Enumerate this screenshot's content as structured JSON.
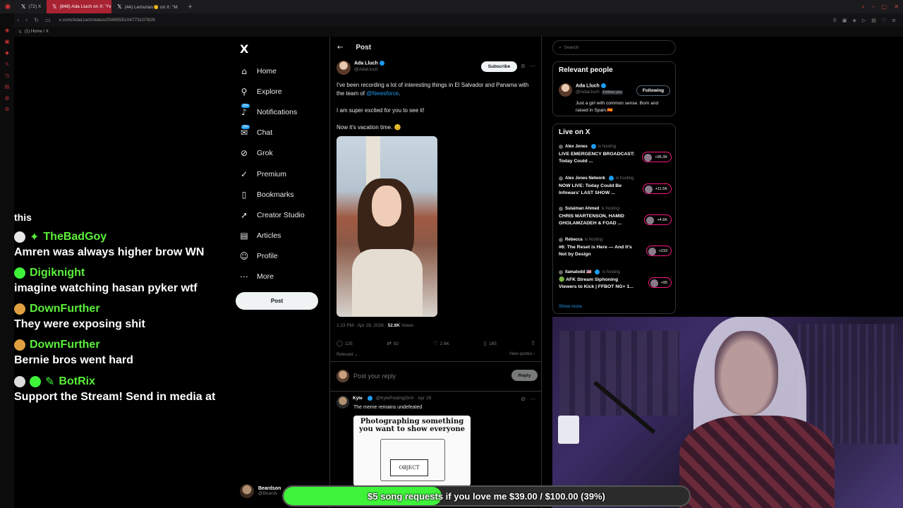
{
  "browser": {
    "tabs": [
      {
        "label": "(72) X",
        "active": false
      },
      {
        "label": "(848) Ada Lluch on X: \"I'v",
        "active": true
      },
      {
        "label": "(44) Lemurian👏 on X: \"M",
        "active": false
      }
    ],
    "url": "x.com/AdaLluch/status/2049555104773107829",
    "bookmark": "(1) Home / X"
  },
  "chat": {
    "partial_top": "this",
    "messages": [
      {
        "user": "TheBadGoy",
        "text": "Amren was always higher brow WN",
        "badge_color": "#e8e8e8"
      },
      {
        "user": "Digiknight",
        "text": "imagine watching hasan pyker wtf",
        "badge_color": "#3ff23a"
      },
      {
        "user": "DownFurther",
        "text": "They were exposing shit",
        "badge_color": "#e0a040"
      },
      {
        "user": "DownFurther",
        "text": "Bernie bros went hard",
        "badge_color": "#e0a040"
      },
      {
        "user": "BotRix",
        "text": "Support the Stream! Send in media at",
        "badge_color": "#3ff23a"
      }
    ]
  },
  "xnav": {
    "logo": "X",
    "items": [
      {
        "label": "Home",
        "icon": "home-icon",
        "glyph": "⌂",
        "badge": ""
      },
      {
        "label": "Explore",
        "icon": "search-icon",
        "glyph": "⚲",
        "badge": ""
      },
      {
        "label": "Notifications",
        "icon": "bell-icon",
        "glyph": "♪",
        "badge": "20+"
      },
      {
        "label": "Chat",
        "icon": "chat-icon",
        "glyph": "✉",
        "badge": "20+"
      },
      {
        "label": "Grok",
        "icon": "grok-icon",
        "glyph": "⊘",
        "badge": ""
      },
      {
        "label": "Premium",
        "icon": "premium-icon",
        "glyph": "✓",
        "badge": ""
      },
      {
        "label": "Bookmarks",
        "icon": "bookmark-icon",
        "glyph": "▯",
        "badge": ""
      },
      {
        "label": "Creator Studio",
        "icon": "rocket-icon",
        "glyph": "➚",
        "badge": ""
      },
      {
        "label": "Articles",
        "icon": "articles-icon",
        "glyph": "▤",
        "badge": ""
      },
      {
        "label": "Profile",
        "icon": "profile-icon",
        "glyph": "☺",
        "badge": ""
      },
      {
        "label": "More",
        "icon": "more-icon",
        "glyph": "⋯",
        "badge": ""
      }
    ],
    "post_button": "Post"
  },
  "post": {
    "header": "Post",
    "author_name": "Ada Lluch",
    "author_handle": "@AdaLluch",
    "subscribe": "Subscribe",
    "text_1a": "I've been recording a lot of interesting things in El Salvador and Panama with the team of ",
    "text_1_link": "@Newsforce",
    "text_1b": ".",
    "text_2": "I am super excited for you to see it!",
    "text_3": "Now it's vacation time. 😊",
    "time": "1:23 PM · Apr 29, 2026 · ",
    "views": "52.8K",
    "views_label": " Views",
    "replies": "125",
    "reposts": "82",
    "likes": "2.6K",
    "bookmarks": "165",
    "relevant": "Relevant ⌄",
    "view_quotes": "View quotes ›",
    "reply_placeholder": "Post your reply",
    "reply_button": "Reply"
  },
  "reply": {
    "name": "Kyle",
    "handle": "@KylePostingOnX · Apr 29",
    "text": "The meme remains undefeated",
    "comic_caption": "Photographing something you want to show everyone",
    "comic_object": "OBJECT"
  },
  "right": {
    "search_placeholder": "Search",
    "relevant_title": "Relevant people",
    "rp_name": "Ada Lluch",
    "rp_handle": "@AdaLluch",
    "rp_follows_you": "Follows you",
    "rp_following": "Following",
    "rp_bio": "Just a girl with common sense. Born and raised in Spain.🇪🇸",
    "live_title": "Live on X",
    "live": [
      {
        "host": "Alex Jones",
        "title": "LIVE EMERGENCY BROADCAST: Today Could ...",
        "count": "+95.3K"
      },
      {
        "host": "Alex Jones Network",
        "title": "NOW LIVE: Today Could Be Infowars' LAST SHOW ...",
        "count": "+11.5K"
      },
      {
        "host": "Sulaiman Ahmed",
        "title": "CHRIS MARTENSON, HAMID GHOLAMZADEH & FOAD ...",
        "count": "+4.6K"
      },
      {
        "host": "Rebecca",
        "title": "#6: The Reset is Here — And It's Not by Design",
        "count": "+233"
      },
      {
        "host": "llamatodd 🇺🇸",
        "title": "🟢 AFK Stream Siphoning Viewers to Kick | FFBOT NG+ 1...",
        "count": "+95"
      }
    ],
    "is_hosting": "is hosting",
    "show_more": "Show more"
  },
  "bottom": {
    "name": "Beardson",
    "handle": "@Beards",
    "goal_label": "$5 song requests if you love me $39.00 / $100.00 (39%)",
    "goal_fraction": 0.39,
    "goal_color": "#3ff23a"
  }
}
